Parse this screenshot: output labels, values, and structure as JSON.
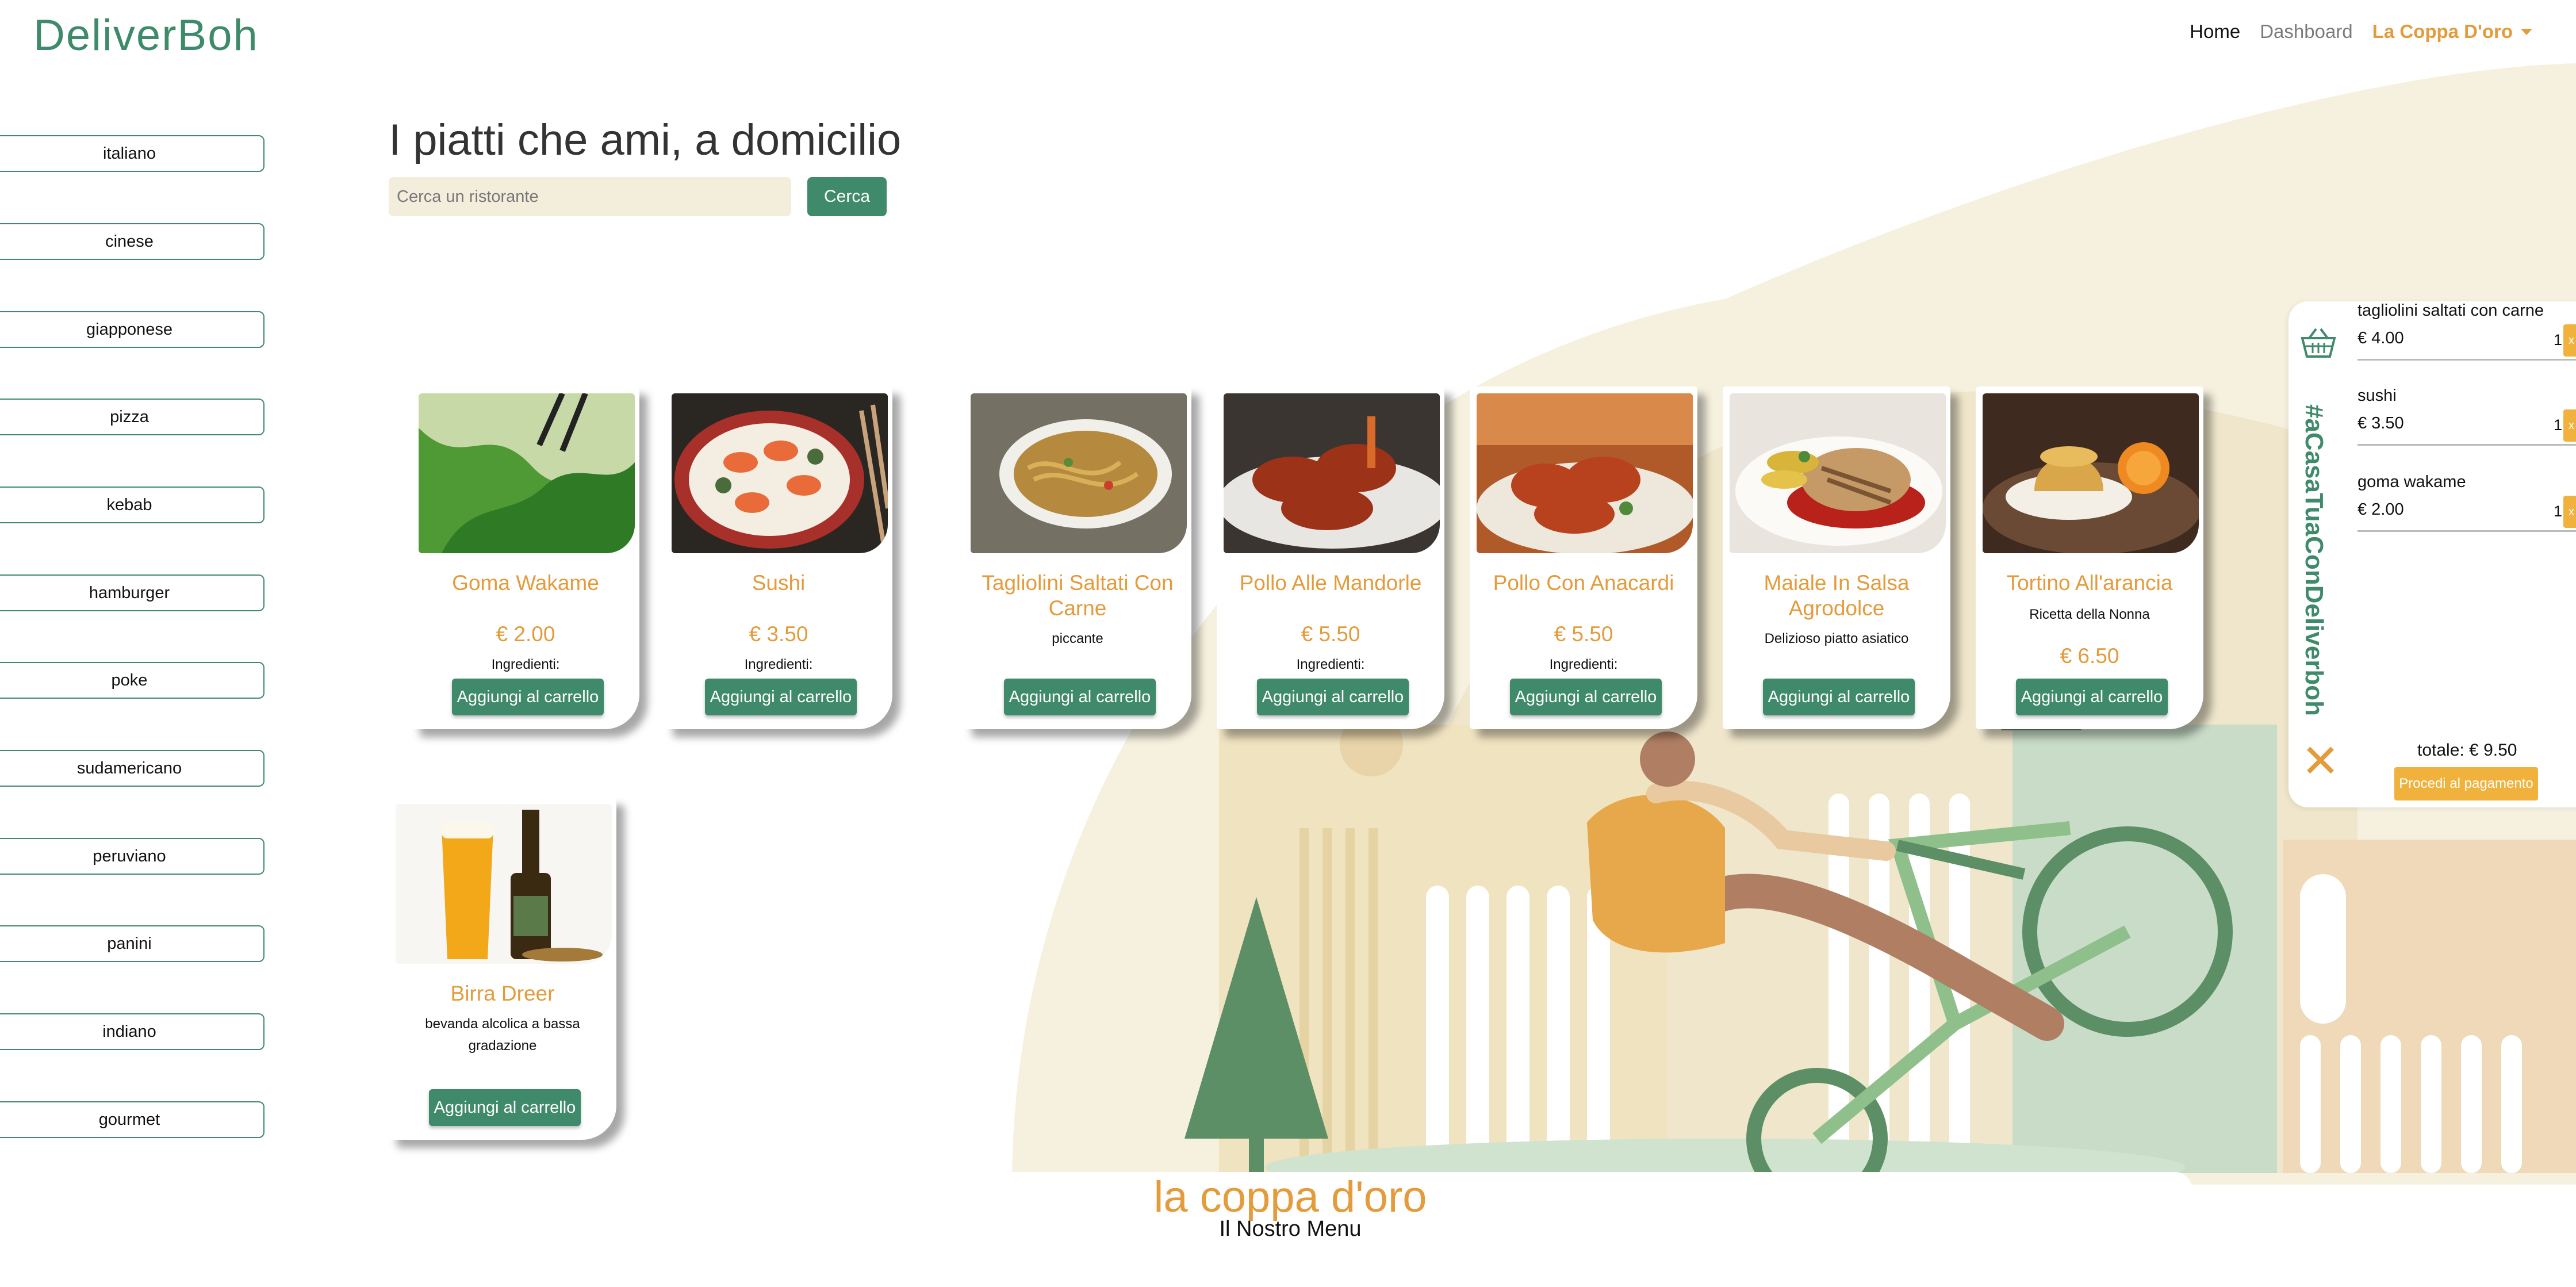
{
  "navbar": {
    "logo": "DeliverBoh",
    "home": "Home",
    "dashboard": "Dashboard",
    "restaurant": "La Coppa D'oro"
  },
  "sidebar": {
    "categories": [
      "italiano",
      "cinese",
      "giapponese",
      "pizza",
      "kebab",
      "hamburger",
      "poke",
      "sudamericano",
      "peruviano",
      "panini",
      "indiano",
      "gourmet"
    ]
  },
  "hero": {
    "title": "I piatti che ami, a domicilio",
    "search_placeholder": "Cerca un ristorante",
    "search_button": "Cerca"
  },
  "products": [
    {
      "name": "Goma Wakame",
      "price": "€ 2.00",
      "ingredients": "Ingredienti:",
      "button": "Aggiungi al carrello"
    },
    {
      "name": "Sushi",
      "price": "€ 3.50",
      "ingredients": "Ingredienti:",
      "button": "Aggiungi al carrello"
    },
    {
      "name": "Tagliolini Saltati Con Carne",
      "description": "piccante",
      "button": "Aggiungi al carrello"
    },
    {
      "name": "Pollo Alle Mandorle",
      "price": "€ 5.50",
      "ingredients": "Ingredienti:",
      "button": "Aggiungi al carrello"
    },
    {
      "name": "Pollo Con Anacardi",
      "price": "€ 5.50",
      "ingredients": "Ingredienti:",
      "button": "Aggiungi al carrello"
    },
    {
      "name": "Maiale In Salsa Agrodolce",
      "description": "Delizioso piatto asiatico",
      "button": "Aggiungi al carrello"
    },
    {
      "name": "Tortino All'arancia",
      "description": "Ricetta della Nonna",
      "price": "€ 6.50",
      "button": "Aggiungi al carrello"
    },
    {
      "name": "Birra Dreer",
      "description": "bevanda alcolica a bassa gradazione",
      "button": "Aggiungi al carrello"
    }
  ],
  "menu": {
    "title": "la coppa d'oro",
    "subtitle": "Il Nostro Menu"
  },
  "cart": {
    "hashtag": "#aCasaTuaConDeliverboh",
    "items": [
      {
        "name": "tagliolini saltati con carne",
        "price": "€ 4.00",
        "qty": "1",
        "remove": "x"
      },
      {
        "name": "sushi",
        "price": "€ 3.50",
        "qty": "1",
        "remove": "x"
      },
      {
        "name": "goma wakame",
        "price": "€ 2.00",
        "qty": "1",
        "remove": "x"
      }
    ],
    "total": "totale: € 9.50",
    "checkout": "Procedi al pagamento"
  },
  "colors": {
    "brand_green": "#3f8a6a",
    "accent_orange": "#e39b3b",
    "checkout_yellow": "#f0b23c"
  },
  "icons": [
    "basket-icon",
    "close-icon",
    "caret-down-icon"
  ]
}
